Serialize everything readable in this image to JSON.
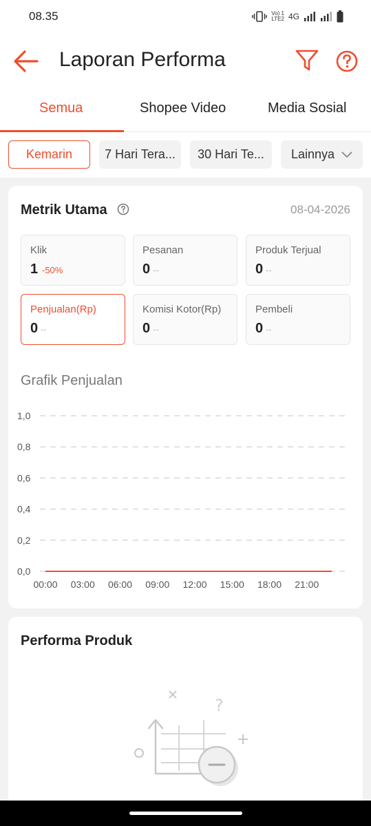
{
  "status_bar": {
    "time": "08.35",
    "network_label_top": "Vo) 1",
    "network_label_bottom": "LTE2",
    "network_type": "4G",
    "icons": [
      "vibrate-icon",
      "signal-icon",
      "signal-icon",
      "battery-icon"
    ]
  },
  "header": {
    "title": "Laporan Performa",
    "back_icon": "arrow-left-icon",
    "filter_icon": "filter-icon",
    "help_icon": "help-circle-icon"
  },
  "tabs": [
    {
      "label": "Semua",
      "active": true
    },
    {
      "label": "Shopee Video",
      "active": false
    },
    {
      "label": "Media Sosial",
      "active": false
    }
  ],
  "periods": [
    {
      "label": "Kemarin",
      "active": true
    },
    {
      "label": "7 Hari Tera...",
      "active": false
    },
    {
      "label": "30 Hari Te...",
      "active": false
    },
    {
      "label": "Lainnya",
      "active": false,
      "icon": "chevron-down-icon"
    }
  ],
  "metrics_card": {
    "title": "Metrik Utama",
    "date": "08-04-2026",
    "metrics": [
      {
        "label": "Klik",
        "value": "1",
        "change": "-50%",
        "active": false
      },
      {
        "label": "Pesanan",
        "value": "0",
        "change": "--",
        "active": false
      },
      {
        "label": "Produk Terjual",
        "value": "0",
        "change": "--",
        "active": false
      },
      {
        "label": "Penjualan(Rp)",
        "value": "0",
        "change": "--",
        "active": true
      },
      {
        "label": "Komisi Kotor(Rp)",
        "value": "0",
        "change": "--",
        "active": false
      },
      {
        "label": "Pembeli",
        "value": "0",
        "change": "--",
        "active": false
      }
    ]
  },
  "chart_data": {
    "type": "line",
    "title": "Grafik Penjualan",
    "xlabel": "",
    "ylabel": "",
    "x_ticks": [
      "00:00",
      "03:00",
      "06:00",
      "09:00",
      "12:00",
      "15:00",
      "18:00",
      "21:00"
    ],
    "y_ticks": [
      "0,0",
      "0,2",
      "0,4",
      "0,6",
      "0,8",
      "1,0"
    ],
    "ylim": [
      0,
      1
    ],
    "xlim": [
      0,
      24
    ],
    "grid": true,
    "line_color": "#ee4d2d",
    "series": [
      {
        "x": [
          0,
          23
        ],
        "y": [
          0,
          0
        ]
      }
    ]
  },
  "product_card": {
    "title": "Performa Produk",
    "illustration_icon": "empty-chart-icon"
  },
  "colors": {
    "accent": "#ee4d2d",
    "background": "#f2f2f2",
    "card": "#ffffff"
  }
}
